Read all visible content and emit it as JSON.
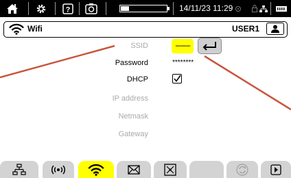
{
  "status_bar": {
    "datetime": "14/11/23 11:29",
    "battery_level": 0.18,
    "icons": [
      "home-icon",
      "settings-gear-icon",
      "help-icon",
      "camera-icon",
      "bluetooth-icon",
      "lock-icon",
      "network-icon",
      "memory-icon"
    ]
  },
  "title_bar": {
    "title": "Wifi",
    "user": "USER1",
    "icons": [
      "wifi-icon",
      "user-icon"
    ]
  },
  "form": {
    "ssid": {
      "label": "SSID",
      "value": "--------"
    },
    "password": {
      "label": "Password",
      "value": "********"
    },
    "dhcp": {
      "label": "DHCP",
      "checked": true
    },
    "ip_address": {
      "label": "IP address"
    },
    "netmask": {
      "label": "Netmask"
    },
    "gateway": {
      "label": "Gateway"
    }
  },
  "tabs": [
    {
      "icon": "ethernet-icon",
      "active": false
    },
    {
      "icon": "wireless-broadcast-icon",
      "active": false
    },
    {
      "icon": "wifi-icon",
      "active": true
    },
    {
      "icon": "email-icon",
      "active": false
    },
    {
      "icon": "server-icon",
      "active": false
    },
    {
      "icon": "",
      "active": false
    },
    {
      "icon": "sync-icon",
      "active": false
    },
    {
      "icon": "play-icon",
      "active": false
    }
  ],
  "colors": {
    "highlight": "#ffff00",
    "annotation": "#c8553d",
    "disabled_text": "#a9a9a9",
    "status_bar_bg": "#000000",
    "tab_bg": "#d3d3d3"
  }
}
